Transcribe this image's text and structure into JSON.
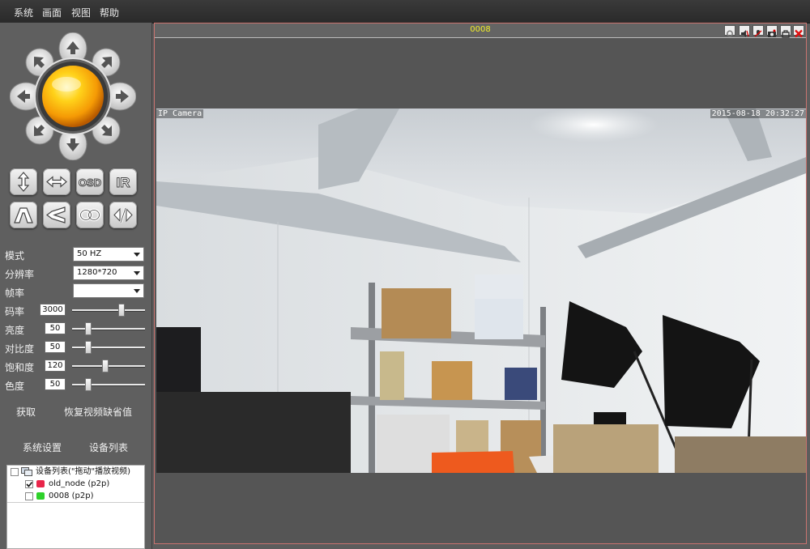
{
  "menubar": {
    "items": [
      "系统",
      "画面",
      "视图",
      "帮助"
    ]
  },
  "controls": {
    "buttons": {
      "up_down": "up-down-arrow-icon",
      "left_right": "left-right-arrow-icon",
      "osd": "OSD",
      "ir": "IR",
      "zoom_in": "zoom-in-icon",
      "zoom_out": "zoom-out-icon",
      "focus_far": "focus-far-icon",
      "focus_near": "focus-near-icon"
    },
    "mode": {
      "label": "模式",
      "value": "50 HZ"
    },
    "resolution": {
      "label": "分辨率",
      "value": "1280*720"
    },
    "framerate": {
      "label": "帧率",
      "value": ""
    },
    "bitrate": {
      "label": "码率",
      "value": "3000",
      "level": 0.69
    },
    "brightness": {
      "label": "亮度",
      "value": "50",
      "level": 0.2
    },
    "contrast": {
      "label": "对比度",
      "value": "50",
      "level": 0.2
    },
    "saturation": {
      "label": "饱和度",
      "value": "120",
      "level": 0.45
    },
    "hue": {
      "label": "色度",
      "value": "50",
      "level": 0.2
    },
    "get_button": "获取",
    "restore_defaults_button": "恢复视频缺省值",
    "system_settings_button": "系统设置",
    "device_list_button": "设备列表"
  },
  "device_tree": {
    "root": "设备列表(\"拖动\"播放视频)",
    "devices": [
      {
        "label": "old_node (p2p)",
        "checked": true,
        "status_color": "#e8254a"
      },
      {
        "label": "0008 (p2p)",
        "checked": false,
        "status_color": "#2ed12a"
      }
    ]
  },
  "viewer": {
    "title": "0008",
    "overlay_name": "IP Camera",
    "overlay_time": "2015-08-18 20:32:27",
    "toolbar_icons": [
      "settings-icon",
      "mute-icon",
      "record-icon",
      "snapshot-icon",
      "fullscreen-icon",
      "close-icon"
    ]
  }
}
